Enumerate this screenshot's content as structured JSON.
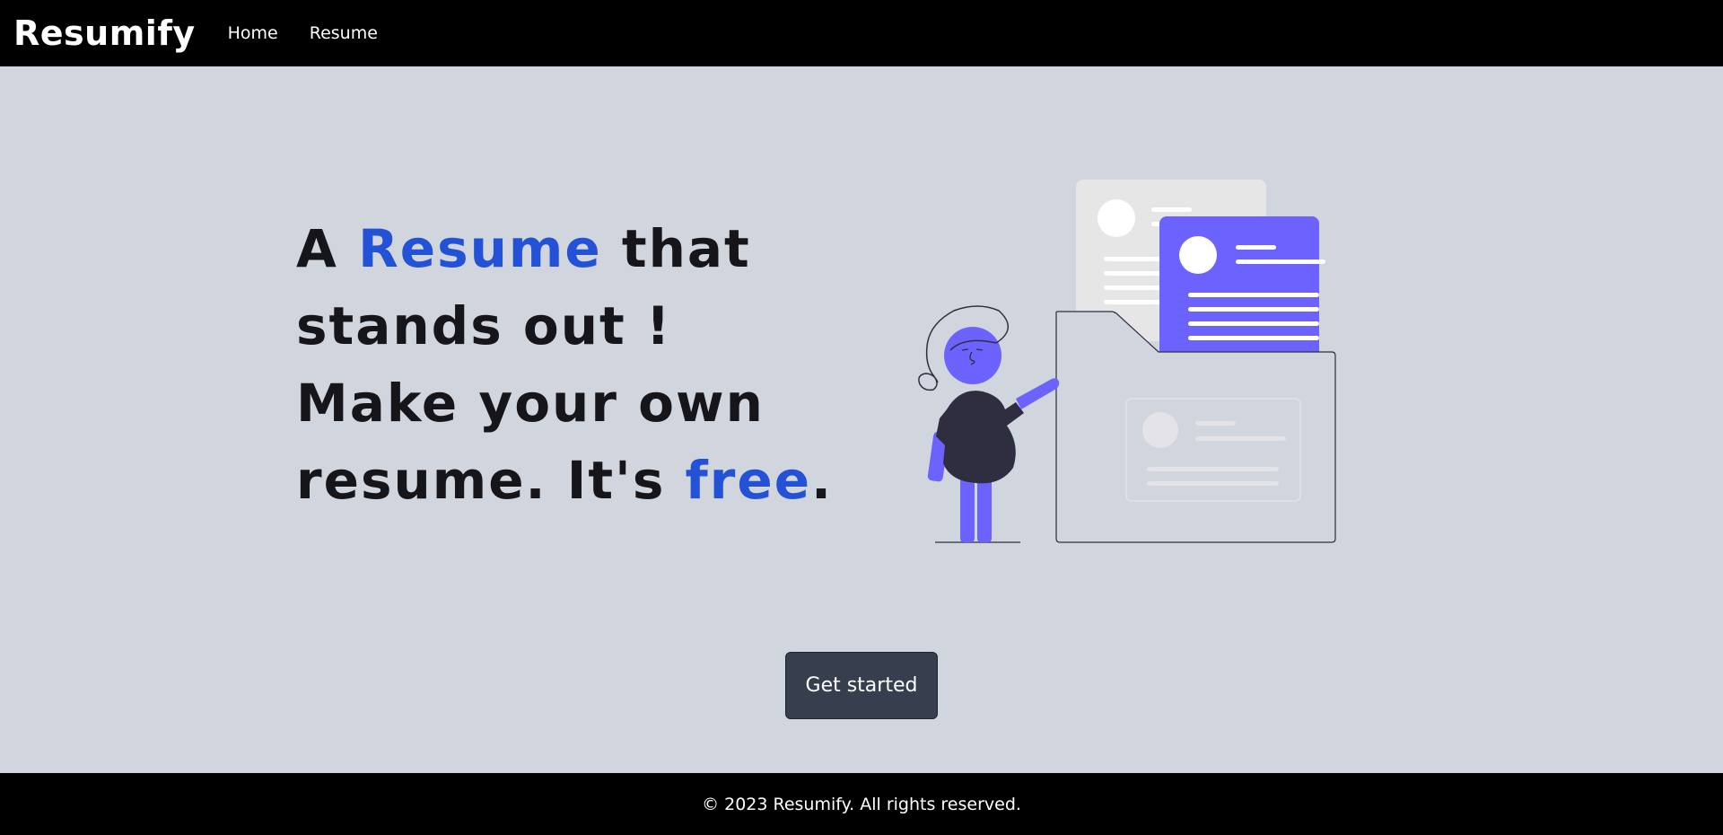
{
  "navbar": {
    "brand": "Resumify",
    "links": [
      {
        "label": "Home"
      },
      {
        "label": "Resume"
      }
    ]
  },
  "hero": {
    "line1_prefix": "A ",
    "line1_accent": "Resume",
    "line1_suffix": " that",
    "line2": "stands out !",
    "line3": "Make your own",
    "line4_prefix": "resume. It's ",
    "line4_accent": "free",
    "line4_suffix": "."
  },
  "cta": {
    "label": "Get started"
  },
  "footer": {
    "text": "© 2023 Resumify. All rights reserved."
  },
  "colors": {
    "background": "#d1d5de",
    "navbar": "#000000",
    "accent_text": "#2452d6",
    "illustration_purple": "#6c63ff",
    "button": "#373f4f"
  },
  "icons": {
    "illustration": "person-filing-resume-illustration"
  }
}
